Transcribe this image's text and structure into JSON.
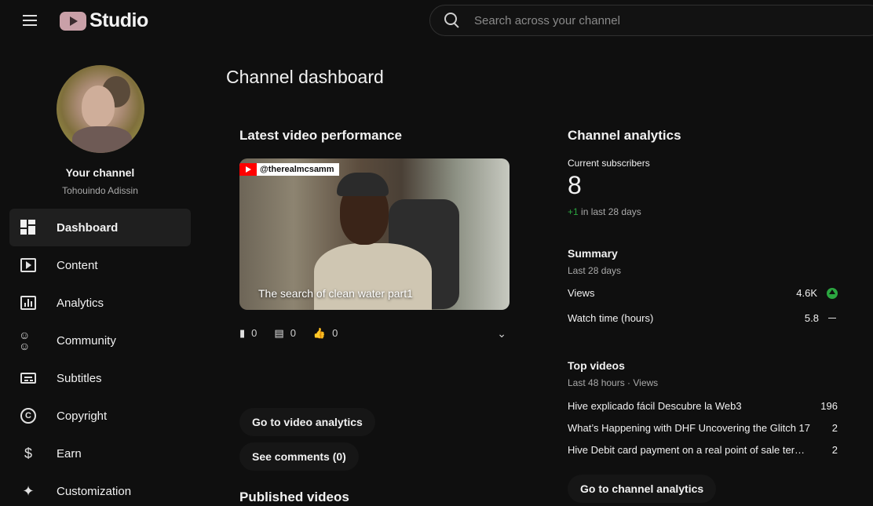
{
  "app": {
    "logo_text": "Studio"
  },
  "search": {
    "placeholder": "Search across your channel"
  },
  "sidebar": {
    "channel_title": "Your channel",
    "channel_handle": "Tohouindo Adissin",
    "items": [
      {
        "label": "Dashboard",
        "icon": "dashboard-icon"
      },
      {
        "label": "Content",
        "icon": "content-icon"
      },
      {
        "label": "Analytics",
        "icon": "analytics-icon"
      },
      {
        "label": "Community",
        "icon": "community-icon"
      },
      {
        "label": "Subtitles",
        "icon": "subtitles-icon"
      },
      {
        "label": "Copyright",
        "icon": "copyright-icon"
      },
      {
        "label": "Earn",
        "icon": "earn-icon"
      },
      {
        "label": "Customization",
        "icon": "customization-icon"
      }
    ]
  },
  "main": {
    "page_title": "Channel dashboard",
    "latest": {
      "title": "Latest video performance",
      "thumb_handle": "@therealmcsamm",
      "video_title": "The search of clean water part1",
      "views": "0",
      "comments": "0",
      "likes": "0",
      "btn_analytics": "Go to video analytics",
      "btn_comments": "See comments (0)"
    },
    "published_title": "Published videos"
  },
  "analytics": {
    "title": "Channel analytics",
    "subs_label": "Current subscribers",
    "subs_value": "8",
    "subs_delta": "+1",
    "subs_delta_text": "in last 28 days",
    "summary_title": "Summary",
    "summary_period": "Last 28 days",
    "metrics": [
      {
        "label": "Views",
        "value": "4.6K",
        "trend": "up"
      },
      {
        "label": "Watch time (hours)",
        "value": "5.8",
        "trend": "flat"
      }
    ],
    "top_title": "Top videos",
    "top_period": "Last 48 hours · Views",
    "top_videos": [
      {
        "title": "Hive explicado fácil Descubre la Web3",
        "views": "196"
      },
      {
        "title": "What’s Happening with DHF Uncovering the Glitch 17",
        "views": "2"
      },
      {
        "title": "Hive Debit card payment on a real point of sale terminal",
        "views": "2"
      }
    ],
    "btn_channel": "Go to channel analytics"
  },
  "colors": {
    "background": "#0f0f0f",
    "accent_green": "#2ba640",
    "logo_pink": "#c9a0a8"
  }
}
